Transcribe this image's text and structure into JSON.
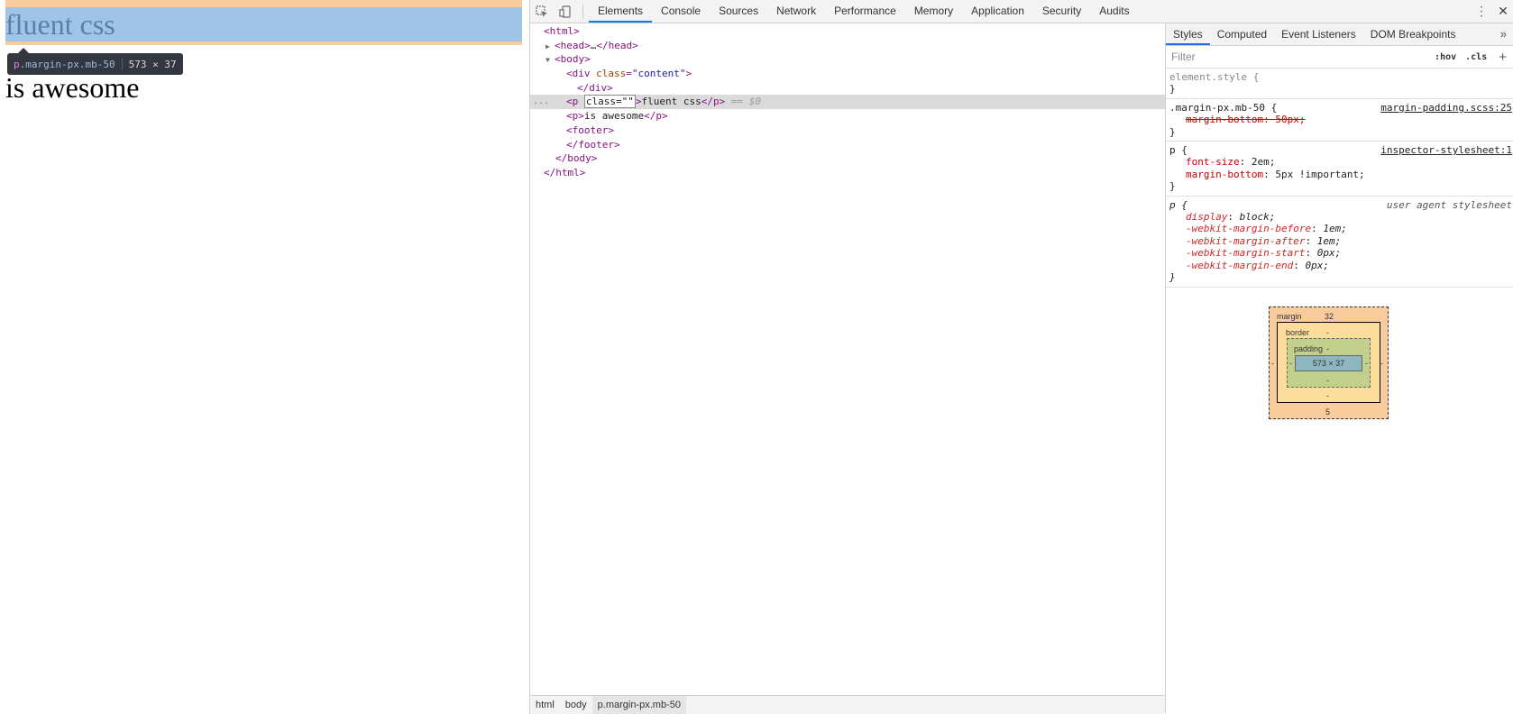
{
  "page": {
    "p1_text": "fluent css",
    "p2_text": "is awesome",
    "tooltip": {
      "tag": "p",
      "classes": ".margin-px.mb-50",
      "size": "573 × 37"
    }
  },
  "devtools": {
    "tabs": [
      "Elements",
      "Console",
      "Sources",
      "Network",
      "Performance",
      "Memory",
      "Application",
      "Security",
      "Audits"
    ],
    "active_tab": "Elements",
    "tree": {
      "html_open": "<html>",
      "head_tag": "<head>",
      "head_ellipsis": "…",
      "head_close": "</head>",
      "body_open": "<body>",
      "div_open_tag": "<div",
      "div_attr": "class",
      "div_val": "\"content\"",
      "div_gt": ">",
      "div_close": "</div>",
      "p_sel_open": "<p",
      "p_sel_edit": "class=\"\"",
      "p_sel_text": "fluent css",
      "p_sel_close": "</p>",
      "p_sel_marker": "== $0",
      "p2_open": "<p>",
      "p2_text": "is awesome",
      "p2_close": "</p>",
      "footer_open": "<footer>",
      "footer_close": "</footer>",
      "body_close": "</body>",
      "html_close": "</html>",
      "row_dots": "..."
    },
    "breadcrumbs": [
      "html",
      "body",
      "p.margin-px.mb-50"
    ],
    "sidebar": {
      "tabs": [
        "Styles",
        "Computed",
        "Event Listeners",
        "DOM Breakpoints"
      ],
      "active_tab": "Styles",
      "more": "»",
      "filter_placeholder": "Filter",
      "hov": ":hov",
      "cls": ".cls",
      "plus": "+",
      "rules": {
        "element_style": {
          "selector": "element.style {",
          "close": "}"
        },
        "margin": {
          "selector": ".margin-px.mb-50 {",
          "source": "margin-padding.scss:25",
          "prop": "margin-bottom",
          "value": "50px;",
          "close": "}"
        },
        "p_inspector": {
          "selector": "p {",
          "source": "inspector-stylesheet:1",
          "prop1": "font-size",
          "value1": "2em;",
          "prop2": "margin-bottom",
          "value2": "5px !important;",
          "close": "}"
        },
        "p_ua": {
          "selector": "p {",
          "source": "user agent stylesheet",
          "decls": [
            {
              "prop": "display",
              "value": "block;"
            },
            {
              "prop": "-webkit-margin-before",
              "value": "1em;"
            },
            {
              "prop": "-webkit-margin-after",
              "value": "1em;"
            },
            {
              "prop": "-webkit-margin-start",
              "value": "0px;"
            },
            {
              "prop": "-webkit-margin-end",
              "value": "0px;"
            }
          ],
          "close": "}"
        }
      },
      "box_model": {
        "margin_label": "margin",
        "margin_top": "32",
        "margin_bottom": "5",
        "margin_left": "-",
        "margin_right": "-",
        "border_label": "border",
        "border_top": "-",
        "border_bottom": "-",
        "padding_label": "padding",
        "padding_top": "-",
        "padding_bottom": "-",
        "padding_left": "-",
        "padding_right": "-",
        "content": "573 × 37"
      }
    }
  }
}
